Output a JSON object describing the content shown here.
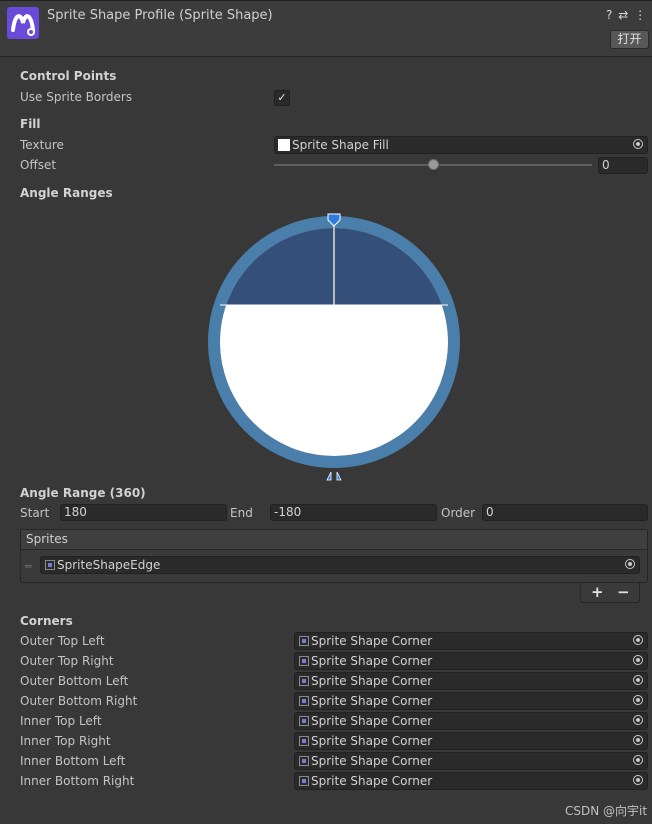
{
  "header": {
    "title": "Sprite Shape Profile (Sprite Shape)",
    "icons": "❓ ⇄ ⋮",
    "open_button": "打开"
  },
  "control_points": {
    "section": "Control Points",
    "use_sprite_borders_label": "Use Sprite Borders",
    "use_sprite_borders_checked": true,
    "check_glyph": "✓"
  },
  "fill": {
    "section": "Fill",
    "texture_label": "Texture",
    "texture_value": "Sprite Shape Fill",
    "offset_label": "Offset",
    "offset_value": "0",
    "offset_slider_fraction": 0.5
  },
  "angle_ranges": {
    "section": "Angle Ranges",
    "range_title": "Angle Range (360)",
    "start_label": "Start",
    "start_value": "180",
    "end_label": "End",
    "end_value": "-180",
    "order_label": "Order",
    "order_value": "0",
    "colors": {
      "ring": "#4a7fab",
      "fill_top": "#34507a",
      "fill_bottom": "#ffffff",
      "handle": "#2d7de0"
    }
  },
  "sprites": {
    "header": "Sprites",
    "items": [
      "SpriteShapeEdge"
    ],
    "add_label": "+",
    "remove_label": "−"
  },
  "corners": {
    "section": "Corners",
    "rows": [
      {
        "label": "Outer Top Left",
        "value": "Sprite Shape Corner"
      },
      {
        "label": "Outer Top Right",
        "value": "Sprite Shape Corner"
      },
      {
        "label": "Outer Bottom Left",
        "value": "Sprite Shape Corner"
      },
      {
        "label": "Outer Bottom Right",
        "value": "Sprite Shape Corner"
      },
      {
        "label": "Inner Top Left",
        "value": "Sprite Shape Corner"
      },
      {
        "label": "Inner Top Right",
        "value": "Sprite Shape Corner"
      },
      {
        "label": "Inner Bottom Left",
        "value": "Sprite Shape Corner"
      },
      {
        "label": "Inner Bottom Right",
        "value": "Sprite Shape Corner"
      }
    ]
  },
  "watermark": "CSDN @向宇it"
}
